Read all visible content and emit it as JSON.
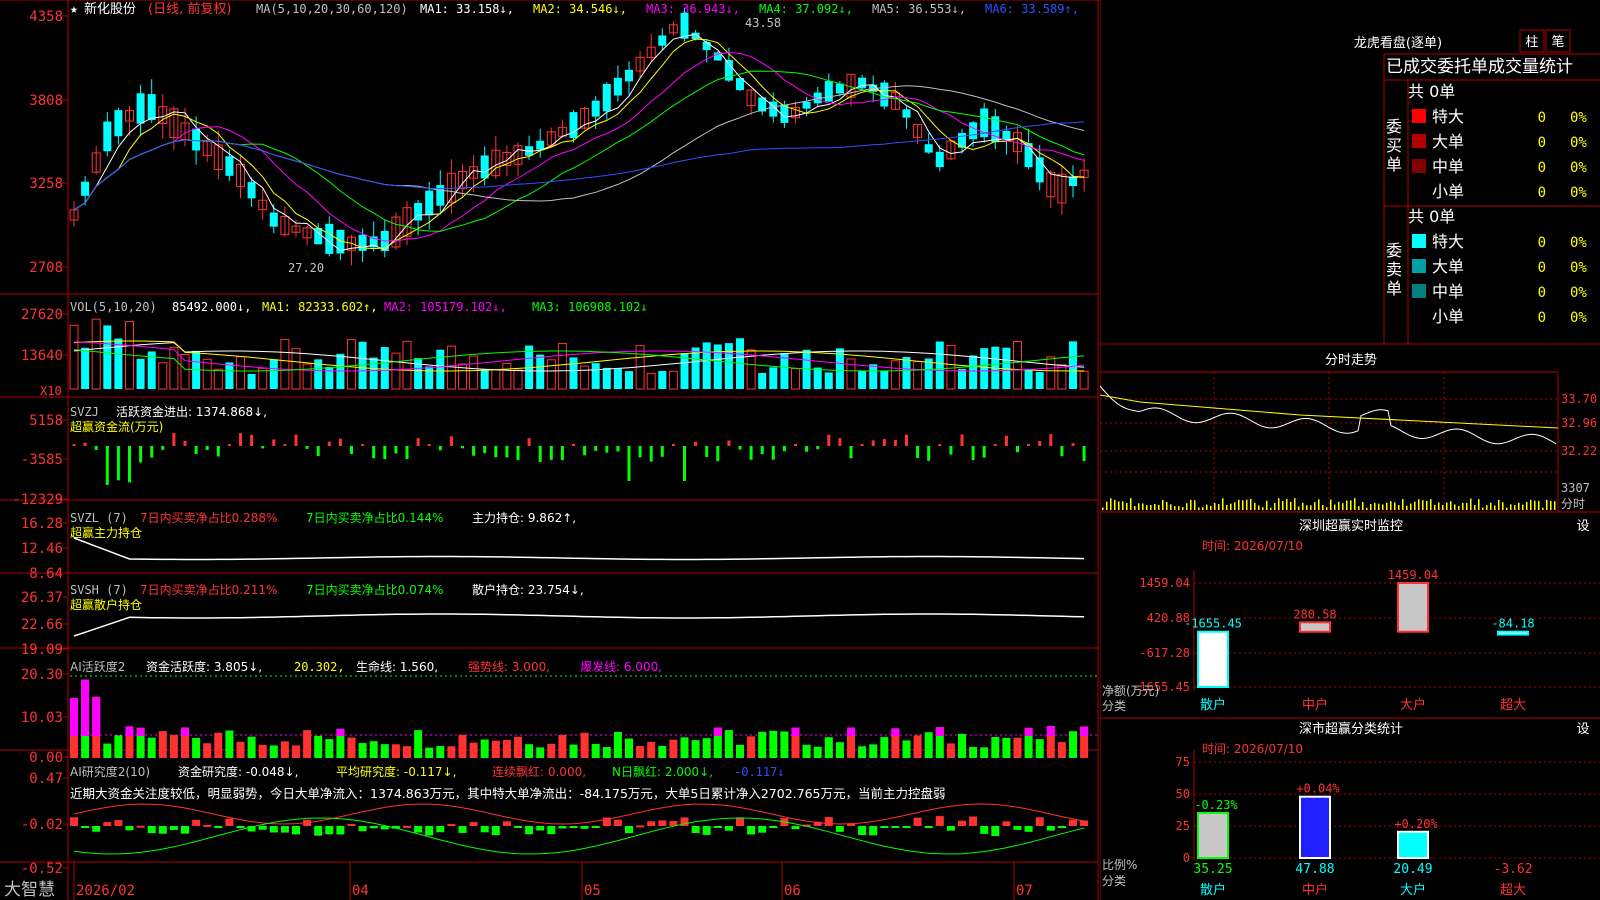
{
  "colors": {
    "up": "#ff3232",
    "down": "#00ffff",
    "grid": "#b00000",
    "text": "#c0c0c0",
    "white": "#ffffff",
    "yellow": "#ffff00",
    "magenta": "#ff00ff",
    "green": "#00ff00",
    "blue": "#3050ff",
    "gray": "#c0c0c0"
  },
  "main": {
    "title_star": "★",
    "stock_name": "新化股份",
    "period": "(日线, 前复权)",
    "ma_label": "MA(5,10,20,30,60,120)",
    "ma_values": [
      {
        "name": "MA1:",
        "value": "33.158",
        "arrow": "↓",
        "color": "#ffffff"
      },
      {
        "name": "MA2:",
        "value": "34.546",
        "arrow": "↓",
        "color": "#ffff00"
      },
      {
        "name": "MA3:",
        "value": "36.943",
        "arrow": "↓",
        "color": "#ff00ff"
      },
      {
        "name": "MA4:",
        "value": "37.092",
        "arrow": "↓",
        "color": "#00ff00"
      },
      {
        "name": "MA5:",
        "value": "36.553",
        "arrow": "↓",
        "color": "#c0c0c0"
      },
      {
        "name": "MA6:",
        "value": "33.589",
        "arrow": "↑",
        "color": "#3050ff"
      }
    ],
    "y_ticks": [
      "4358",
      "3808",
      "3258",
      "2708"
    ],
    "high_label": "43.58",
    "low_label": "27.20"
  },
  "vol": {
    "label": "VOL(5,10,20)",
    "value": "85492.000↓,",
    "ma1": "MA1: 82333.602↑,",
    "ma2": "MA2: 105179.102↓,",
    "ma3": "MA3: 106908.102↓",
    "y_ticks": [
      "27620",
      "13640"
    ],
    "unit": "X10"
  },
  "svzj": {
    "label": "SVZJ",
    "desc": "活跃资金进出: 1374.868↓,",
    "sub": "超赢资金流(万元)",
    "y_ticks": [
      "5158",
      "-3585",
      "-12329"
    ]
  },
  "svzl": {
    "label": "SVZL (7)",
    "p1": "7日内买卖净占比0.288%",
    "p2": "7日内买卖净占比0.144%",
    "p3": "主力持仓: 9.862↑,",
    "sub": "超赢主力持仓",
    "y_ticks": [
      "16.28",
      "12.46",
      "8.64"
    ]
  },
  "svsh": {
    "label": "SVSH (7)",
    "p1": "7日内买卖净占比0.211%",
    "p2": "7日内买卖净占比0.074%",
    "p3": "散户持仓: 23.754↓,",
    "sub": "超赢散户持仓",
    "y_ticks": [
      "26.37",
      "22.66",
      "19.09"
    ]
  },
  "ai1": {
    "label": "AI活跃度2",
    "p1": "资金活跃度: 3.805↓,",
    "p2": "20.302,",
    "p3": "生命线: 1.560,",
    "p4": "强势线: 3.000,",
    "p5": "爆发线: 6.000,",
    "y_ticks": [
      "20.30",
      "10.03",
      "0.00"
    ]
  },
  "ai2": {
    "label": "AI研究度2(10)",
    "p1": "资金研究度: -0.048↓,",
    "p2": "平均研究度: -0.117↓,",
    "p3": "连续飘红: 0.000,",
    "p4": "N日飘红: 2.000↓,",
    "p5": "-0.117↓",
    "comment": "近期大资金关注度较低，明显弱势，今日大单净流入：1374.863万元，其中特大单净流出：-84.175万元，大单5日累计净入2702.765万元，当前主力控盘弱",
    "y_ticks": [
      "0.47",
      "-0.02",
      "-0.52"
    ]
  },
  "bottom": {
    "brand": "大智慧",
    "dates": [
      "2026/02",
      "04",
      "05",
      "06",
      "07"
    ]
  },
  "lhk": {
    "title": "龙虎看盘(逐单)",
    "btn1": "柱",
    "btn2": "笔",
    "header": "已成交委托单成交量统计",
    "buy_label": "委买单",
    "sell_label": "委卖单",
    "buy_total": "共 0单",
    "sell_total": "共 0单",
    "buy_rows": [
      {
        "name": "特大",
        "v": "0",
        "p": "0%",
        "c": "#ff0000"
      },
      {
        "name": "大单",
        "v": "0",
        "p": "0%",
        "c": "#b00000"
      },
      {
        "name": "中单",
        "v": "0",
        "p": "0%",
        "c": "#800000"
      },
      {
        "name": "小单",
        "v": "0",
        "p": "0%",
        "c": ""
      }
    ],
    "sell_rows": [
      {
        "name": "特大",
        "v": "0",
        "p": "0%",
        "c": "#00ffff"
      },
      {
        "name": "大单",
        "v": "0",
        "p": "0%",
        "c": "#00a0a0"
      },
      {
        "name": "中单",
        "v": "0",
        "p": "0%",
        "c": "#008080"
      },
      {
        "name": "小单",
        "v": "0",
        "p": "0%",
        "c": ""
      }
    ]
  },
  "intraday": {
    "title": "分时走势",
    "y_ticks": [
      "33.70",
      "32.96",
      "32.22"
    ],
    "vol_tick": "3307",
    "footer": "分时"
  },
  "sz_monitor": {
    "title": "深圳超赢实时监控",
    "btn": "设",
    "time": "时间: 2026/07/10",
    "y_ticks": [
      "1459.04",
      "420.88",
      "-617.28",
      "-1655.45"
    ],
    "y_label1": "净额(万元)",
    "y_label2": "分类",
    "categories": [
      "散户",
      "中户",
      "大户",
      "超大"
    ],
    "values": [
      -1655.45,
      280.58,
      1459.04,
      -84.18
    ],
    "value_labels": [
      "-1655.45",
      "280.58",
      "1459.04",
      "-84.18"
    ]
  },
  "sz_stats": {
    "title": "深市超赢分类统计",
    "btn": "设",
    "time": "时间: 2026/07/10",
    "y_ticks": [
      "75",
      "50",
      "25",
      "0"
    ],
    "y_label1": "比例%",
    "y_label2": "分类",
    "categories": [
      "散户",
      "中户",
      "大户",
      "超大"
    ],
    "values": [
      35.25,
      47.88,
      20.49,
      -3.62
    ],
    "changes": [
      "-0.23%",
      "+0.04%",
      "+0.20%",
      ""
    ],
    "value_labels": [
      "35.25",
      "47.88",
      "20.49",
      "-3.62"
    ]
  },
  "chart_data": [
    {
      "type": "candlestick",
      "title": "新化股份 (日线, 前复权)",
      "y_ticks": [
        43.58,
        38.08,
        32.58,
        27.08
      ],
      "high": 43.58,
      "low": 27.2,
      "series": [
        {
          "name": "MA1",
          "last": 33.158
        },
        {
          "name": "MA2",
          "last": 34.546
        },
        {
          "name": "MA3",
          "last": 36.943
        },
        {
          "name": "MA4",
          "last": 37.092
        },
        {
          "name": "MA5",
          "last": 36.553
        },
        {
          "name": "MA6",
          "last": 33.589
        }
      ]
    },
    {
      "type": "bar",
      "title": "深圳超赢实时监控",
      "categories": [
        "散户",
        "中户",
        "大户",
        "超大"
      ],
      "values": [
        -1655.45,
        280.58,
        1459.04,
        -84.18
      ],
      "ylabel": "净额(万元)",
      "ylim": [
        -1655.45,
        1459.04
      ]
    },
    {
      "type": "bar",
      "title": "深市超赢分类统计",
      "categories": [
        "散户",
        "中户",
        "大户",
        "超大"
      ],
      "values": [
        35.25,
        47.88,
        20.49,
        -3.62
      ],
      "ylabel": "比例%",
      "ylim": [
        0,
        75
      ]
    }
  ]
}
